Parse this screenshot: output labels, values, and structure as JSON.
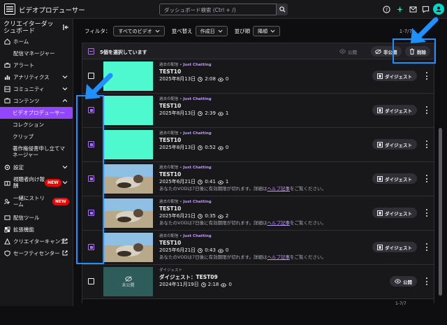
{
  "topbar": {
    "title": "ビデオプロデューサー",
    "search_placeholder": "ダッシュボード検索 (Ctrl + /)"
  },
  "sidebar": {
    "header": "クリエイターダッシュボード",
    "items": {
      "home": "ホーム",
      "stream_manager": "配信マネージャー",
      "alerts": "アラート",
      "analytics": "アナリティクス",
      "community": "コミュニティ",
      "content": "コンテンツ",
      "video_producer": "ビデオプロデューサー",
      "collections": "コレクション",
      "clips": "クリップ",
      "copyright": "著作権侵害申し立てマネージャー",
      "settings": "設定",
      "viewer_rewards": "視聴者向け報酬",
      "stream_together": "一緒にストリーム",
      "extensions_tools": "配信ツール",
      "extensions": "拡張機能",
      "creator_camp": "クリエイターキャンプ",
      "safety_center": "セーフティセンター"
    },
    "new_badge": "NEW"
  },
  "filters": {
    "filter_label": "フィルタ：",
    "filter_value": "すべてのビデオ",
    "sort_label": "並べ替え",
    "sort_value": "作成日",
    "order_label": "並び順",
    "order_value": "降順",
    "count_top": "1-7/7",
    "count_bottom": "1-7/7"
  },
  "selection_bar": {
    "label": "5個を選択しています",
    "public": "公開",
    "private": "非公開",
    "delete": "削除"
  },
  "videos": [
    {
      "source": "過去の配信",
      "category": "Just Chatting",
      "title": "TEST10",
      "date": "2025年8月13日",
      "duration": "2:08",
      "views": "0",
      "warning_prefix": "",
      "warning_link": "",
      "warning_suffix": "",
      "checked": false,
      "thumb": "teal",
      "action": "ダイジェスト"
    },
    {
      "source": "過去の配信",
      "category": "Just Chatting",
      "title": "TEST10",
      "date": "2025年8月13日",
      "duration": "2:39",
      "views": "1",
      "warning_prefix": "",
      "warning_link": "",
      "warning_suffix": "",
      "checked": true,
      "thumb": "teal",
      "action": "ダイジェスト"
    },
    {
      "source": "過去の配信",
      "category": "Just Chatting",
      "title": "TEST10",
      "date": "2025年8月13日",
      "duration": "0:52",
      "views": "0",
      "warning_prefix": "",
      "warning_link": "",
      "warning_suffix": "",
      "checked": true,
      "thumb": "teal",
      "action": "ダイジェスト"
    },
    {
      "source": "過去の配信",
      "category": "Just Chatting",
      "title": "TEST10",
      "date": "2025年6月21日",
      "duration": "0:41",
      "views": "1",
      "warning_prefix": "あなたのVODは7日後に有効期限が切れます。詳細は",
      "warning_link": "ヘルプ記事",
      "warning_suffix": "をご覧ください。",
      "checked": true,
      "thumb": "dog",
      "action": "ダイジェスト"
    },
    {
      "source": "過去の配信",
      "category": "Just Chatting",
      "title": "TEST10",
      "date": "2025年6月21日",
      "duration": "0:35",
      "views": "2",
      "warning_prefix": "あなたのVODは7日後に有効期限が切れます。詳細は",
      "warning_link": "ヘルプ記事",
      "warning_suffix": "をご覧ください。",
      "checked": true,
      "thumb": "dog",
      "action": "ダイジェスト"
    },
    {
      "source": "過去の配信",
      "category": "Just Chatting",
      "title": "TEST10",
      "date": "2025年6月21日",
      "duration": "0:43",
      "views": "0",
      "warning_prefix": "あなたのVODは7日後に有効期限が切れます。詳細は",
      "warning_link": "ヘルプ記事",
      "warning_suffix": "をご覧ください。",
      "checked": true,
      "thumb": "dog",
      "action": "ダイジェスト"
    },
    {
      "source": "ダイジェスト",
      "category": "",
      "title": "ダイジェスト：TEST09",
      "date": "2024年11月19日",
      "duration": "2:18",
      "views": "0",
      "warning_prefix": "",
      "warning_link": "",
      "warning_suffix": "",
      "checked": false,
      "thumb": "dark",
      "thumb_label": "未公開",
      "action": "公開"
    }
  ],
  "colors": {
    "accent": "#9147ff",
    "highlight": "#1e90ff",
    "thumb_teal": "#4ff9cf"
  }
}
